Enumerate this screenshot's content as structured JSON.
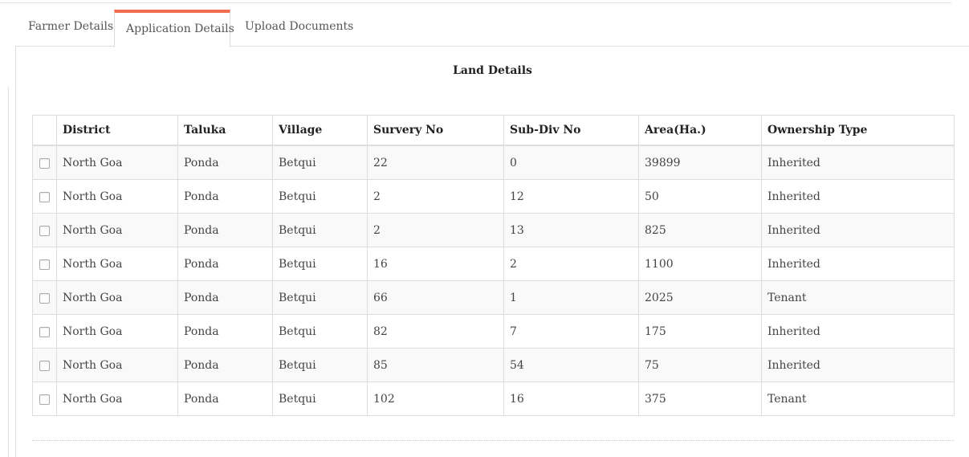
{
  "tabs": [
    {
      "label": "Farmer Details",
      "active": false
    },
    {
      "label": "Application Details",
      "active": true
    },
    {
      "label": "Upload Documents",
      "active": false
    }
  ],
  "accent_color": "#f26c50",
  "section_title": "Land Details",
  "table": {
    "headers": [
      "District",
      "Taluka",
      "Village",
      "Survery No",
      "Sub-Div No",
      "Area(Ha.)",
      "Ownership Type"
    ],
    "rows": [
      [
        "North Goa",
        "Ponda",
        "Betqui",
        "22",
        "0",
        "39899",
        "Inherited"
      ],
      [
        "North Goa",
        "Ponda",
        "Betqui",
        "2",
        "12",
        "50",
        "Inherited"
      ],
      [
        "North Goa",
        "Ponda",
        "Betqui",
        "2",
        "13",
        "825",
        "Inherited"
      ],
      [
        "North Goa",
        "Ponda",
        "Betqui",
        "16",
        "2",
        "1100",
        "Inherited"
      ],
      [
        "North Goa",
        "Ponda",
        "Betqui",
        "66",
        "1",
        "2025",
        "Tenant"
      ],
      [
        "North Goa",
        "Ponda",
        "Betqui",
        "82",
        "7",
        "175",
        "Inherited"
      ],
      [
        "North Goa",
        "Ponda",
        "Betqui",
        "85",
        "54",
        "75",
        "Inherited"
      ],
      [
        "North Goa",
        "Ponda",
        "Betqui",
        "102",
        "16",
        "375",
        "Tenant"
      ]
    ],
    "row_checked": [
      false,
      false,
      false,
      false,
      false,
      false,
      false,
      false
    ]
  }
}
